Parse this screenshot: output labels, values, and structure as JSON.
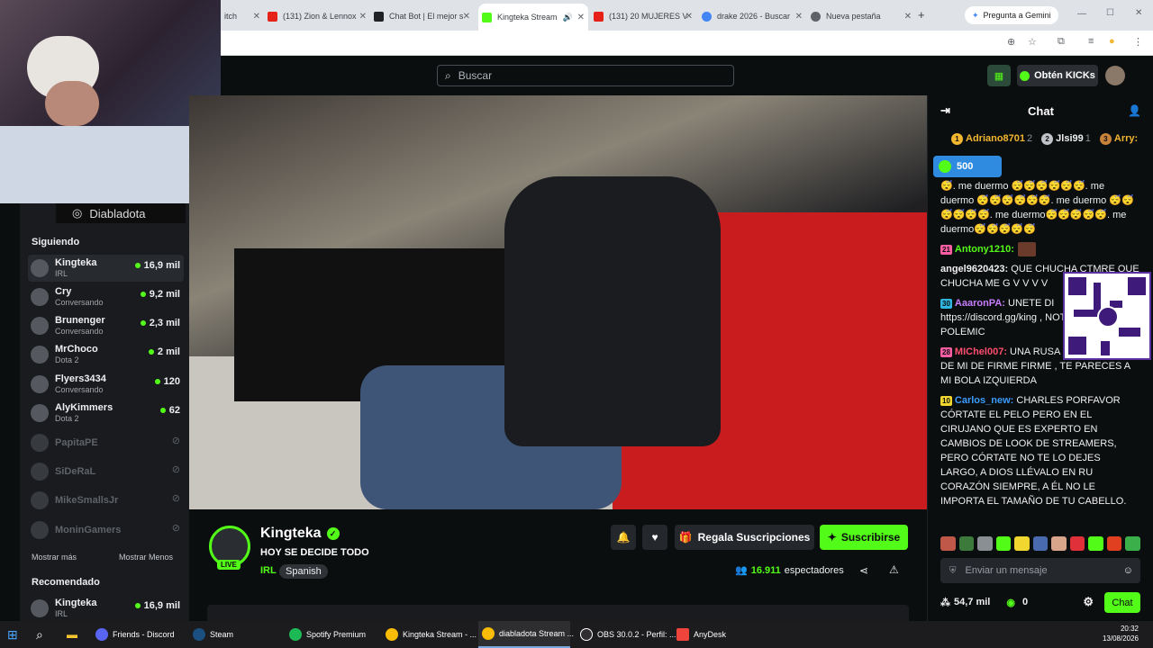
{
  "browser": {
    "tabs": [
      {
        "label": "itch",
        "active": false
      },
      {
        "label": "(131) Zion & Lennox",
        "active": false
      },
      {
        "label": "Chat Bot | El mejor s",
        "active": false
      },
      {
        "label": "Kingteka Stream",
        "active": true
      },
      {
        "label": "(131) 20 MUJERES V",
        "active": false
      },
      {
        "label": "drake 2026 - Buscar",
        "active": false
      },
      {
        "label": "Nueva pestaña",
        "active": false
      }
    ],
    "gemini_label": "Pregunta a Gemini"
  },
  "header": {
    "search_placeholder": "Buscar",
    "kicks_label": "Obtén KICKs"
  },
  "webcam": {
    "instagram_handle": "Diabladota"
  },
  "sidebar": {
    "following_title": "Siguiendo",
    "following": [
      {
        "name": "Kingteka",
        "sub": "IRL",
        "viewers": "16,9 mil",
        "live": true
      },
      {
        "name": "Cry",
        "sub": "Conversando",
        "viewers": "9,2 mil",
        "live": true
      },
      {
        "name": "Brunenger",
        "sub": "Conversando",
        "viewers": "2,3 mil",
        "live": true
      },
      {
        "name": "MrChoco",
        "sub": "Dota 2",
        "viewers": "2 mil",
        "live": true
      },
      {
        "name": "Flyers3434",
        "sub": "Conversando",
        "viewers": "120",
        "live": true
      },
      {
        "name": "AlyKimmers",
        "sub": "Dota 2",
        "viewers": "62",
        "live": true
      },
      {
        "name": "PapitaPE",
        "sub": "",
        "viewers": "",
        "live": false
      },
      {
        "name": "SiDeRaL",
        "sub": "",
        "viewers": "",
        "live": false
      },
      {
        "name": "MikeSmallsJr",
        "sub": "",
        "viewers": "",
        "live": false
      },
      {
        "name": "MoninGamers",
        "sub": "",
        "viewers": "",
        "live": false
      }
    ],
    "show_more": "Mostrar más",
    "show_less": "Mostrar Menos",
    "recommended_title": "Recomendado",
    "recommended": [
      {
        "name": "Kingteka",
        "sub": "IRL",
        "viewers": "16,9 mil"
      }
    ]
  },
  "channel": {
    "name": "Kingteka",
    "title": "HOY SE DECIDE TODO",
    "category": "IRL",
    "language": "Spanish",
    "live_badge": "LIVE",
    "gift_label": "Regala Suscripciones",
    "subscribe_label": "Suscribirse",
    "viewers": "16.911",
    "viewers_label": "espectadores"
  },
  "chat": {
    "title": "Chat",
    "gifters": [
      {
        "rank": "1",
        "name": "Adriano8701",
        "count": "2"
      },
      {
        "rank": "2",
        "name": "Jlsi99",
        "count": "1"
      },
      {
        "rank": "3",
        "name": "Arry:",
        "count": ""
      }
    ],
    "pinned_amount": "500",
    "messages": [
      {
        "badge": "",
        "badge_color": "",
        "user": "",
        "user_color": "#efeff1",
        "text": "😴. me duermo 😴😴😴😴😴😴. me duermo 😴😴😴😴😴😴. me duermo 😴😴😴😴😴😴. me duermo😴😴😴😴😴. me duermo😴😴😴😴😴"
      },
      {
        "badge": "21",
        "badge_color": "#ff5fa2",
        "user": "Antony1210:",
        "user_color": "#53fc18",
        "text": ""
      },
      {
        "badge": "",
        "badge_color": "",
        "user": "angel9620423:",
        "user_color": "#efeff1",
        "text": " QUE CHUCHA CTMRE QUE CHUCHA ME G V V V V"
      },
      {
        "badge": "30",
        "badge_color": "#2fb5e0",
        "user": "AaaronPA:",
        "user_color": "#c77dff",
        "text": " UNETE DI https://discord.gg/king , NOTICIAS, MEMES, POLEMIC"
      },
      {
        "badge": "28",
        "badge_color": "#ff5fa2",
        "user": "MIChel007:",
        "user_color": "#ff4d6d",
        "text": " UNA RUSA SE ENAMORO DE MI DE FIRME FIRME , TE PARECES A MI BOLA IZQUIERDA"
      },
      {
        "badge": "10",
        "badge_color": "#f2d630",
        "user": "Carlos_new:",
        "user_color": "#3b9cff",
        "text": " CHARLES PORFAVOR CÓRTATE EL PELO PERO EN EL CIRUJANO QUE ES EXPERTO EN CAMBIOS DE LOOK DE STREAMERS, PERO CÓRTATE NO TE LO DEJES LARGO, A DIOS LLÉVALO EN RU CORAZÓN SIEMPRE, A ÉL NO LE IMPORTA EL TAMAÑO DE TU CABELLO."
      }
    ],
    "input_placeholder": "Enviar un mensaje",
    "points": "54,7 mil",
    "kicks": "0",
    "send_label": "Chat"
  },
  "taskbar": {
    "items": [
      {
        "label": "Friends - Discord"
      },
      {
        "label": "Steam"
      },
      {
        "label": "Spotify Premium"
      },
      {
        "label": "Kingteka Stream - ..."
      },
      {
        "label": "diabladota Stream ..."
      },
      {
        "label": "OBS 30.0.2 - Perfil: ..."
      },
      {
        "label": "AnyDesk"
      }
    ],
    "time": "20:32",
    "date": "13/08/2026"
  },
  "colors": {
    "kick_green": "#53fc18",
    "bg": "#0b0e0f",
    "panel": "#191b1f"
  }
}
